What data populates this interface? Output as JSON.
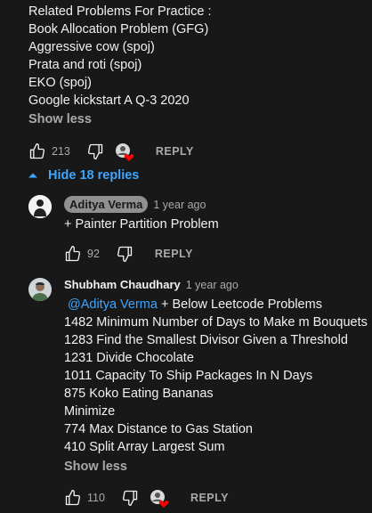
{
  "top_comment": {
    "lines": [
      "Related Problems For Practice :",
      "Book Allocation Problem (GFG)",
      "Aggressive cow (spoj)",
      "Prata and roti (spoj)",
      "EKO (spoj)",
      "Google kickstart A Q-3 2020"
    ],
    "show_less": "Show less",
    "likes": "213",
    "reply": "REPLY"
  },
  "replies_toggle": {
    "label": "Hide 18 replies",
    "color": "#3ea6ff"
  },
  "reply1": {
    "author": "Aditya Verma",
    "time": "1 year ago",
    "text": "+ Painter Partition Problem",
    "likes": "92",
    "reply": "REPLY"
  },
  "reply2": {
    "author": "Shubham Chaudhary",
    "time": "1 year ago",
    "mention": "@Aditya Verma",
    "first_line_rest": " + Below Leetcode Problems",
    "lines": [
      "1482 Minimum Number of Days to Make m Bouquets",
      "1283 Find the Smallest Divisor Given a Threshold",
      "1231 Divide Chocolate",
      "1011 Capacity To Ship Packages In N Days",
      "875 Koko Eating Bananas",
      "Minimize",
      "774 Max Distance to Gas Station",
      "410 Split Array Largest Sum"
    ],
    "show_less": "Show less",
    "likes": "110",
    "reply": "REPLY"
  },
  "icons": {
    "like": "thumbs-up-icon",
    "dislike": "thumbs-down-icon",
    "creator_heart": "creator-heart-icon",
    "collapse": "caret-up-icon"
  },
  "colors": {
    "background": "#181818",
    "text": "#f1f1f1",
    "muted": "#aaaaaa",
    "link": "#3ea6ff",
    "heart": "#ff0000"
  }
}
